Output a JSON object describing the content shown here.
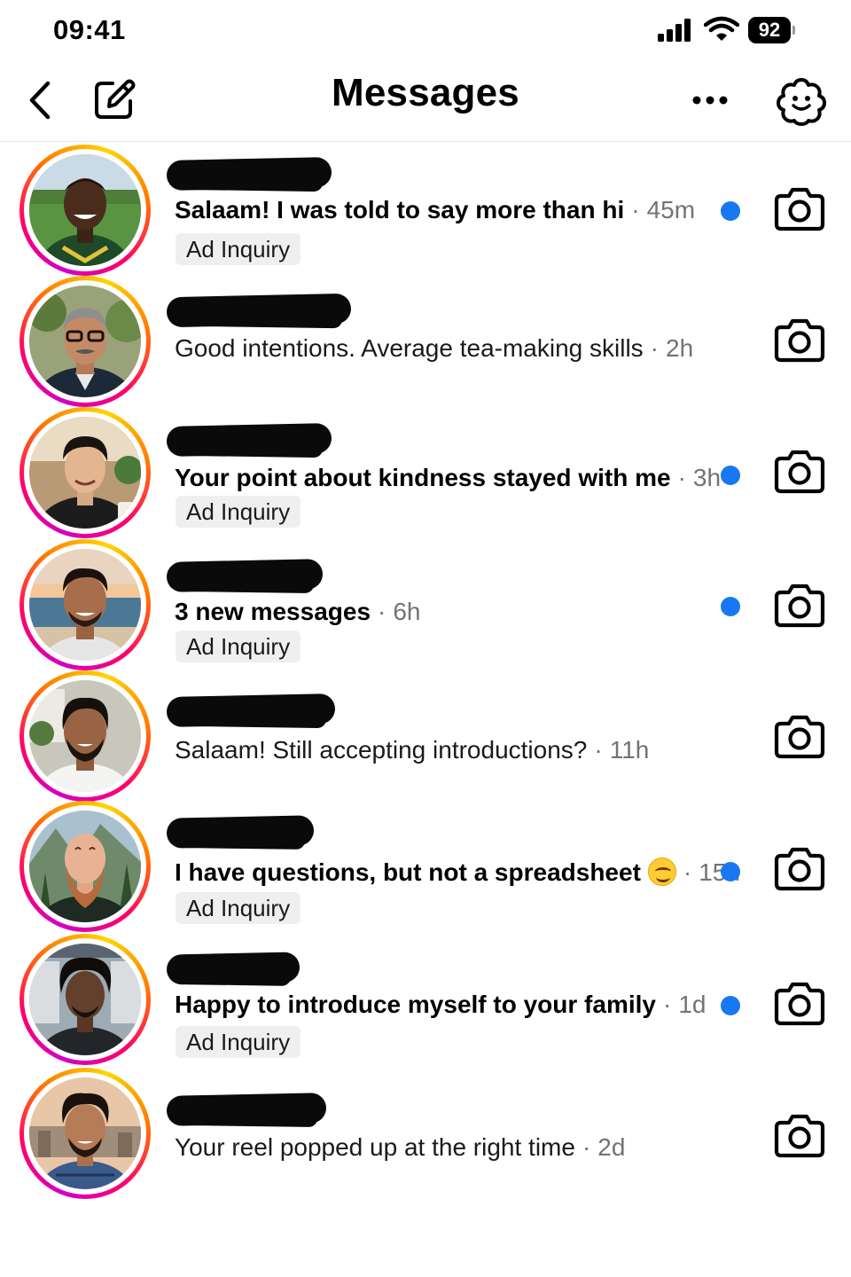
{
  "status_bar": {
    "time": "09:41",
    "battery": "92"
  },
  "header": {
    "title": "Messages",
    "back_icon": "chevron-left-icon",
    "compose_icon": "compose-icon",
    "more_icon": "more-horizontal-icon",
    "ai_icon": "ai-assistant-icon"
  },
  "threads": [
    {
      "message": "Salaam! I was told to say more than hi",
      "separator": "·",
      "time": "45m",
      "unread": true,
      "tag": "Ad Inquiry"
    },
    {
      "message": "Good intentions. Average tea-making skills",
      "separator": "·",
      "time": "2h",
      "unread": false,
      "tag": ""
    },
    {
      "message": "Your point about kindness stayed with me",
      "separator": "·",
      "time": "3h",
      "unread": true,
      "tag": "Ad Inquiry"
    },
    {
      "message": "3 new messages",
      "separator": "·",
      "time": "6h",
      "unread": true,
      "tag": "Ad Inquiry"
    },
    {
      "message": "Salaam! Still accepting introductions?",
      "separator": "·",
      "time": "11h",
      "unread": false,
      "tag": ""
    },
    {
      "message": "I have questions, but not a spreadsheet",
      "separator": "·",
      "time": "15h",
      "unread": true,
      "tag": "Ad Inquiry",
      "emoji": "smiling-face"
    },
    {
      "message": "Happy to introduce myself to your family",
      "separator": "·",
      "time": "1d",
      "unread": true,
      "tag": "Ad Inquiry"
    },
    {
      "message": "Your reel popped up at the right time",
      "separator": "·",
      "time": "2d",
      "unread": false,
      "tag": ""
    }
  ],
  "colors": {
    "unread_dot": "#1877f2",
    "story_ring_start": "#d300c5",
    "story_ring_end": "#ffd600",
    "secondary_text": "#737373",
    "tag_bg": "#efefef"
  }
}
